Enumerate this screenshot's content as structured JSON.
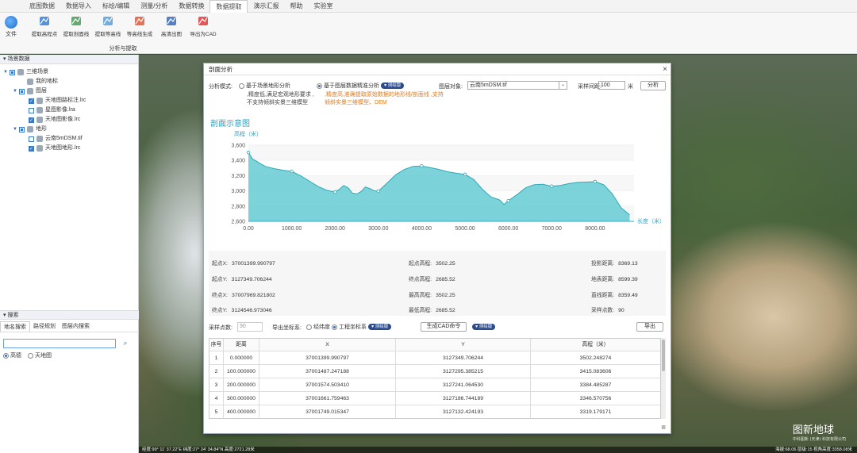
{
  "menu": [
    "底图数据",
    "数据导入",
    "标绘/编辑",
    "测量/分析",
    "数据转换",
    "数据提取",
    "演示汇报",
    "帮助",
    "实验室"
  ],
  "menu_active": 5,
  "ribbon": {
    "file_label": "文件",
    "tools": [
      {
        "label": "提取高程点",
        "icon": "elevation-point-icon"
      },
      {
        "label": "提取剖面线",
        "icon": "profile-line-icon"
      },
      {
        "label": "提取等高线",
        "icon": "contour-icon"
      },
      {
        "label": "等高线生成",
        "icon": "contour-generate-icon"
      },
      {
        "label": "高清出图",
        "icon": "scissors-icon"
      },
      {
        "label": "导出为CAD",
        "icon": "cad-export-icon"
      }
    ],
    "group_label": "分析与提取"
  },
  "left_panel": {
    "title": "场景数据",
    "tree": [
      {
        "label": "三维场景",
        "level": 0,
        "check": "half",
        "expand": "▼",
        "icon": "globe-icon"
      },
      {
        "label": "我的地标",
        "level": 1,
        "check": "none",
        "expand": "",
        "icon": "pin-icon"
      },
      {
        "label": "图层",
        "level": 1,
        "check": "half",
        "expand": "▼",
        "icon": "layers-icon"
      },
      {
        "label": "天地图路标注.lrc",
        "level": 2,
        "check": "on",
        "expand": "",
        "icon": "layer-file-icon"
      },
      {
        "label": "星图影像.lra",
        "level": 2,
        "check": "off",
        "expand": "",
        "icon": "layer-file-icon"
      },
      {
        "label": "天地图影像.lrc",
        "level": 2,
        "check": "on",
        "expand": "",
        "icon": "layer-file-icon"
      },
      {
        "label": "地形",
        "level": 1,
        "check": "half",
        "expand": "▼",
        "icon": "terrain-icon"
      },
      {
        "label": "云南5mDSM.tif",
        "level": 2,
        "check": "off",
        "expand": "",
        "icon": "layer-file-icon"
      },
      {
        "label": "天地图地形.lrc",
        "level": 2,
        "check": "on",
        "expand": "",
        "icon": "layer-file-icon"
      }
    ],
    "search_title": "搜索",
    "search_tabs": [
      "地名搜索",
      "路径规划",
      "图层内搜索"
    ],
    "search_placeholder": "",
    "search_sources": [
      "高德",
      "天地图"
    ]
  },
  "map": {
    "watermark": "图新地球",
    "watermark_small": "中科图新 (天津) 科技有限公司",
    "status_left": "经度:99° 11' 37.22\"E  纬度:27° 24' 34.84\"N  高度:2721.28米",
    "status_right": "海拔:68.06  层级:15  视角高度:3358.08米"
  },
  "dialog": {
    "title": "剖面分析",
    "mode_label": "分析模式:",
    "mode1": "基于场景地形分析",
    "mode1_desc": ",精度低,满足宏观地形要求 ,不支持倾斜实景三维模型",
    "mode2": "基于图层数据精准分析",
    "mode2_badge": "测绘版",
    "mode2_desc": ",精度高,准确提取原始数据的地形线/剖面线 ,支持倾斜实景三维模型、DEM",
    "layer_label": "图层对象:",
    "layer_value": "云南5mDSM.tif",
    "interval_label": "采样间距:",
    "interval_value": "100",
    "interval_unit": "米",
    "analyze_btn": "分析",
    "info": {
      "start_x_l": "起点X:",
      "start_x": "37001399.990797",
      "start_y_l": "起点Y:",
      "start_y": "3127349.706244",
      "end_x_l": "终点X:",
      "end_x": "37007969.821802",
      "end_y_l": "终点Y:",
      "end_y": "3124546.973046",
      "start_h_l": "起点高程:",
      "start_h": "3502.25",
      "end_h_l": "终点高程:",
      "end_h": "2685.52",
      "max_h_l": "最高高程:",
      "max_h": "3502.25",
      "min_h_l": "最低高程:",
      "min_h": "2685.52",
      "proj_l": "投影距离:",
      "proj": "8369.13",
      "surf_l": "地表距离:",
      "surf": "8599.39",
      "line_l": "直线距离:",
      "line": "8359.49",
      "samp_l": "采样点数:",
      "samp": "90"
    },
    "export": {
      "points_label": "采样点数:",
      "points_placeholder": "90",
      "coord_label": "导出坐标系:",
      "opt1": "经纬度",
      "opt2": "工程坐标系",
      "badge": "测绘版",
      "cad_btn": "生成CAD命令",
      "cad_badge": "测绘版",
      "export_btn": "导出"
    },
    "table": {
      "headers": [
        "序号",
        "距离",
        "X",
        "Y",
        "高程（米）"
      ],
      "rows": [
        [
          "1",
          "0.000000",
          "37001399.990797",
          "3127349.706244",
          "3502.248274"
        ],
        [
          "2",
          "100.000000",
          "37001487.247188",
          "3127295.385215",
          "3415.083606"
        ],
        [
          "3",
          "200.000000",
          "37001574.503410",
          "3127241.064530",
          "3384.485287"
        ],
        [
          "4",
          "300.000000",
          "37001661.759463",
          "3127186.744189",
          "3346.570756"
        ],
        [
          "5",
          "400.000000",
          "37001749.015347",
          "3127132.424193",
          "3319.179171"
        ]
      ]
    }
  },
  "chart_data": {
    "type": "area",
    "title": "剖面示意图",
    "ylabel": "高程（米）",
    "xlabel": "长度（米）",
    "xlim": [
      0,
      8900
    ],
    "ylim": [
      2600,
      3650
    ],
    "xticks": [
      0,
      1000,
      2000,
      3000,
      4000,
      5000,
      6000,
      7000,
      8000
    ],
    "xtick_labels": [
      "0.00",
      "1000.00",
      "2000.00",
      "3000.00",
      "4000.00",
      "5000.00",
      "6000.00",
      "7000.00",
      "8000.00"
    ],
    "yticks": [
      2600,
      2800,
      3000,
      3200,
      3400,
      3600
    ],
    "ytick_labels": [
      "2,600",
      "2,800",
      "3,000",
      "3,200",
      "3,400",
      "3,600"
    ],
    "color": "#5bc8d0",
    "grid": true,
    "series": [
      {
        "x": [
          0,
          100,
          200,
          300,
          400,
          600,
          800,
          1000,
          1200,
          1400,
          1600,
          1800,
          1900,
          2000,
          2100,
          2200,
          2300,
          2400,
          2500,
          2600,
          2700,
          2800,
          2900,
          3000,
          3200,
          3400,
          3600,
          3800,
          4000,
          4200,
          4400,
          4600,
          4800,
          5000,
          5200,
          5400,
          5600,
          5700,
          5800,
          5900,
          6000,
          6200,
          6400,
          6600,
          6800,
          7000,
          7200,
          7400,
          7600,
          7800,
          8000,
          8200,
          8400,
          8600,
          8800
        ],
        "y": [
          3502,
          3415,
          3384,
          3347,
          3319,
          3290,
          3270,
          3255,
          3200,
          3130,
          3060,
          3010,
          2995,
          2985,
          3020,
          3070,
          3040,
          2970,
          2960,
          2990,
          3050,
          3030,
          3000,
          2995,
          3100,
          3210,
          3280,
          3320,
          3325,
          3305,
          3280,
          3250,
          3230,
          3215,
          3150,
          3020,
          2920,
          2900,
          2880,
          2820,
          2870,
          2950,
          3040,
          3080,
          3085,
          3060,
          3070,
          3095,
          3110,
          3115,
          3120,
          3080,
          2960,
          2780,
          2685
        ]
      }
    ],
    "markers_x": [
      0,
      1000,
      2000,
      3000,
      4000,
      5000,
      6000,
      7000,
      8000
    ]
  }
}
